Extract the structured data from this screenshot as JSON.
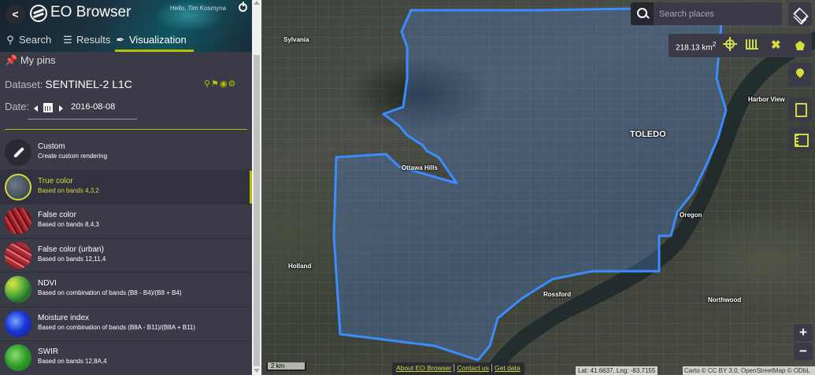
{
  "header": {
    "app_title": "EO Browser",
    "user_greeting": "Hello, Tim Kosmyna"
  },
  "tabs": [
    {
      "label": "Search",
      "icon": "search-icon"
    },
    {
      "label": "Results",
      "icon": "sliders-icon"
    },
    {
      "label": "Visualization",
      "icon": "brush-icon",
      "active": true
    }
  ],
  "pins": {
    "label": "My pins"
  },
  "dataset": {
    "label": "Dataset:",
    "value": "SENTINEL-2 L1C"
  },
  "date": {
    "label": "Date:",
    "value": "2016-08-08"
  },
  "layers": [
    {
      "name": "Custom",
      "description": "Create custom rendering"
    },
    {
      "name": "True color",
      "description": "Based on bands 4,3,2",
      "active": true
    },
    {
      "name": "False color",
      "description": "Based on bands 8,4,3"
    },
    {
      "name": "False color (urban)",
      "description": "Based on bands 12,11,4"
    },
    {
      "name": "NDVI",
      "description": "Based on combination of bands (B8 - B4)/(B8 + B4)"
    },
    {
      "name": "Moisture index",
      "description": "Based on combination of bands (B8A - B11)/(B8A + B11)"
    },
    {
      "name": "SWIR",
      "description": "Based on bands 12,8A,4"
    }
  ],
  "search": {
    "placeholder": "Search places"
  },
  "aoi": {
    "area_value": "218.13 km",
    "area_unit_sup": "2"
  },
  "map_labels": {
    "sylvania": "Sylvania",
    "ottawa_hills": "Ottawa Hills",
    "toledo": "TOLEDO",
    "harbor_view": "Harbor View",
    "oregon": "Oregon",
    "holland": "Holland",
    "rossford": "Rossford",
    "northwood": "Northwood"
  },
  "zoom": {
    "in": "+",
    "out": "−"
  },
  "scale": {
    "label": "2 km"
  },
  "bottom_links": [
    "About EO Browser",
    "Contact us",
    "Get data"
  ],
  "coords": "Lat: 41.6637, Lng: -83.7155",
  "attribution": "Carto © CC BY 3.0, OpenStreetMap © ODbL",
  "colors": {
    "accent": "#b6bf00",
    "aoi_outline": "#3b8cff",
    "sidebar": "#3b3b48"
  }
}
